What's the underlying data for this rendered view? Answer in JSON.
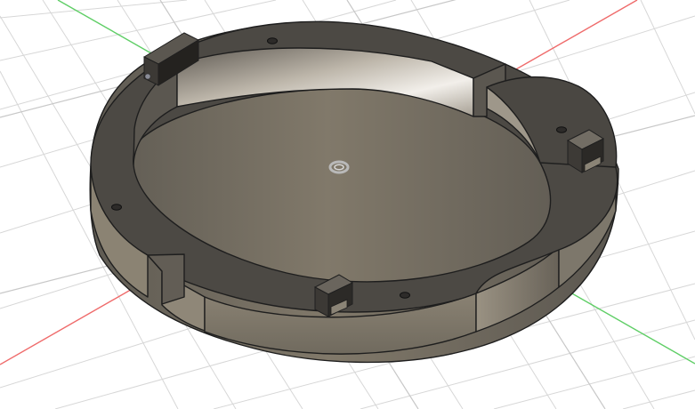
{
  "viewport": {
    "background_color": "#ffffff",
    "grid_color": "#d7d7d7",
    "x_axis_color": "#ef6b6b",
    "y_axis_color": "#5fce66",
    "model_top_color": "#4c4944",
    "model_side_color": "#777064",
    "model_inner_wall_color": "#d6d1c8",
    "model_edge_color": "#1e1e1e",
    "origin_marker_icon": "origin-marker-icon"
  }
}
